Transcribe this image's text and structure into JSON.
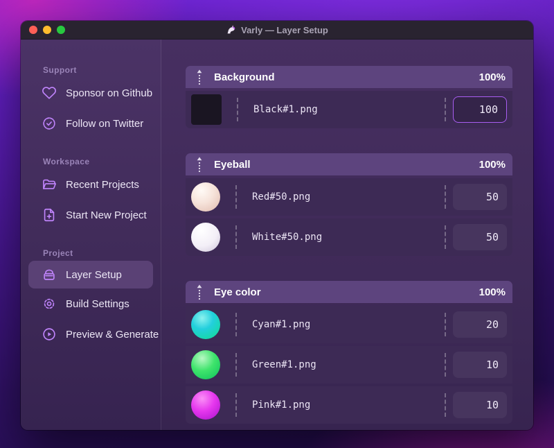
{
  "titlebar": {
    "title": "Varly — Layer Setup",
    "app_icon": "unicorn"
  },
  "window_controls": {
    "close": "red",
    "minimize": "yellow",
    "zoom": "green"
  },
  "sidebar": {
    "sections": [
      {
        "label": "Support",
        "items": [
          {
            "label": "Sponsor on Github",
            "icon": "heart-icon"
          },
          {
            "label": "Follow on Twitter",
            "icon": "verified-badge-icon"
          }
        ]
      },
      {
        "label": "Workspace",
        "items": [
          {
            "label": "Recent Projects",
            "icon": "folder-open-icon"
          },
          {
            "label": "Start New Project",
            "icon": "file-plus-icon"
          }
        ]
      },
      {
        "label": "Project",
        "items": [
          {
            "label": "Layer Setup",
            "icon": "layer-box-icon",
            "selected": true
          },
          {
            "label": "Build Settings",
            "icon": "gear-icon",
            "selected": false
          },
          {
            "label": "Preview & Generate",
            "icon": "play-circle-icon",
            "selected": false
          }
        ]
      }
    ]
  },
  "groups": [
    {
      "title": "Background",
      "percent": "100%",
      "rows": [
        {
          "filename": "Black#1.png",
          "value": "100",
          "focused": true,
          "thumb": "#1a1522",
          "shape": "square"
        }
      ]
    },
    {
      "title": "Eyeball",
      "percent": "100%",
      "rows": [
        {
          "filename": "Red#50.png",
          "value": "50",
          "focused": false,
          "thumb": "radial-gradient(circle at 35% 28%, #fffaf6 0%, #f6e3da 45%, #dfb9ad 100%)",
          "shape": "circle"
        },
        {
          "filename": "White#50.png",
          "value": "50",
          "focused": false,
          "thumb": "radial-gradient(circle at 35% 28%, #ffffff 0%, #f3eff7 55%, #cdc4d9 100%)",
          "shape": "circle"
        }
      ]
    },
    {
      "title": "Eye color",
      "percent": "100%",
      "rows": [
        {
          "filename": "Cyan#1.png",
          "value": "20",
          "focused": false,
          "thumb": "radial-gradient(circle at 38% 28%, #8df2ef 0%, #23cfdd 40%, #10dd8d 100%)",
          "shape": "circle"
        },
        {
          "filename": "Green#1.png",
          "value": "10",
          "focused": false,
          "thumb": "radial-gradient(circle at 38% 28%, #b9f8c4 0%, #3fe46c 45%, #0cc15b 100%)",
          "shape": "circle"
        },
        {
          "filename": "Pink#1.png",
          "value": "10",
          "focused": false,
          "thumb": "radial-gradient(circle at 38% 28%, #fa90f6 0%, #e637ee 45%, #a912cb 100%)",
          "shape": "circle"
        }
      ]
    }
  ],
  "colors": {
    "accent_icon": "#c084fc",
    "focus_border": "#a95df2",
    "group_header_bg": "#5d447e",
    "row_bg": "#3d2a55"
  }
}
